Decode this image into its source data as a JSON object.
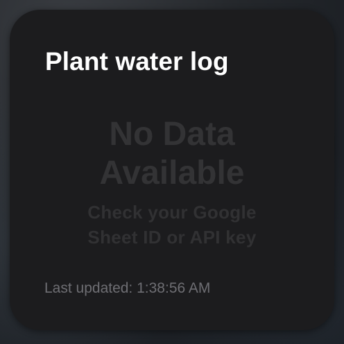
{
  "widget": {
    "title": "Plant water log",
    "empty_heading": "No Data Available",
    "empty_subtext": "Check your Google Sheet ID or API key",
    "last_updated": "Last updated: 1:38:56 AM"
  }
}
